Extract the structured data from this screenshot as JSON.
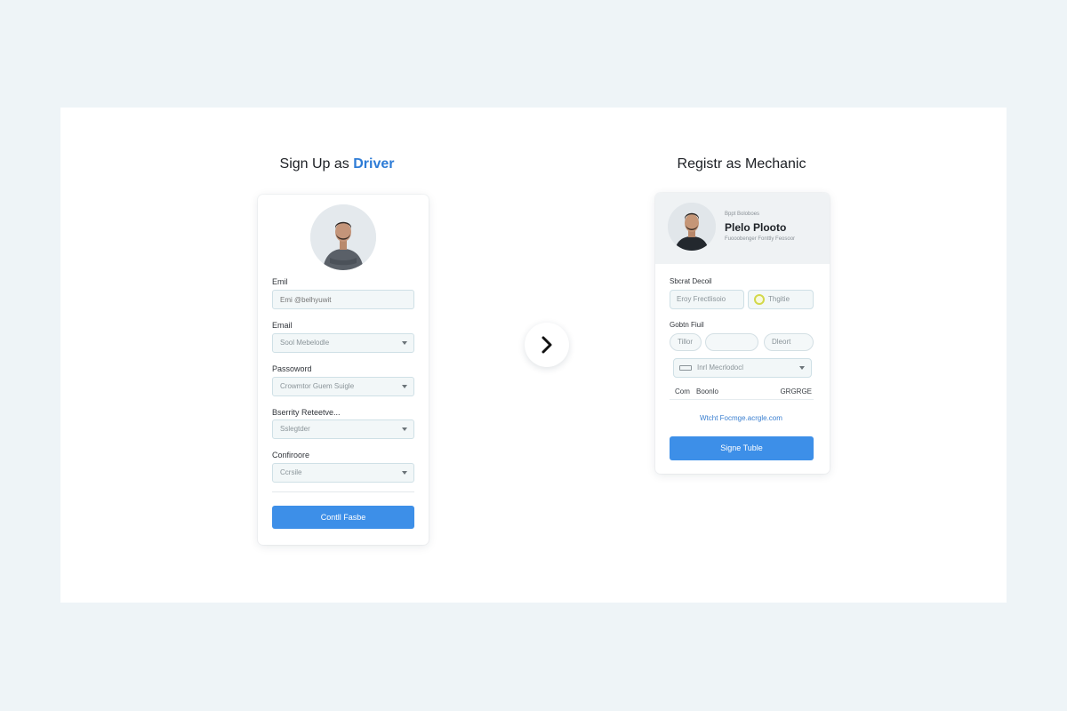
{
  "driver": {
    "heading_prefix": "Sign Up as ",
    "heading_accent": "Driver",
    "fields": [
      {
        "label": "Emil",
        "placeholder": "Emi @belhyuwit"
      },
      {
        "label": "Email",
        "value": "Sool Mebelodle"
      },
      {
        "label": "Passoword",
        "value": "Crowmtor Guem Suigle"
      },
      {
        "label": "Bserrity Reteetve...",
        "value": "Sslegtder"
      },
      {
        "label": "Confiroore",
        "value": "Ccrsile"
      }
    ],
    "submit_label": "Contll Fasbe"
  },
  "mechanic": {
    "heading": "Registr as Mechanic",
    "profile": {
      "kicker": "Bppt Boloboes",
      "name": "Plelo Plooto",
      "subtitle": "Fuooobenger Fonttly Feosoor"
    },
    "section1_label": "Sbcrat Decoil",
    "input1_value": "Eroy Frectlisoio",
    "input2_value": "Thgitie",
    "section2_label": "Gobtn Fiuil",
    "pill1_value": "Tillor",
    "pill3_value": "Dleort",
    "select_value": "Inrl Mecrlodocl",
    "row_left": "Com",
    "row_middle": "Boonlo",
    "row_right": "GRGRGE",
    "link": "Wtcht Focmge.acrgle.com",
    "submit_label": "Signe Tuble"
  },
  "colors": {
    "accent": "#2e7cd6",
    "button": "#3d8fe8",
    "background": "#eef4f7"
  }
}
